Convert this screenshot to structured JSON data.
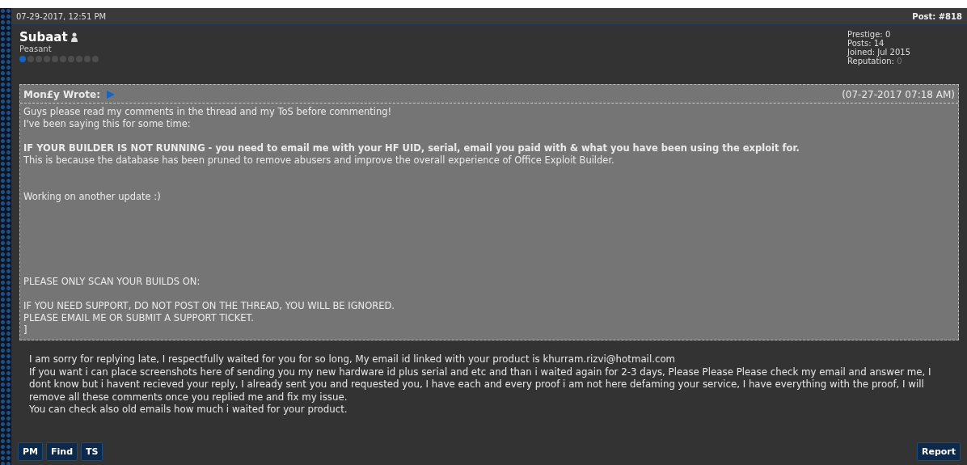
{
  "post": {
    "date": "07-29-2017, 12:51 PM",
    "number": "Post: #818"
  },
  "author": {
    "name": "Subaat",
    "title": "Peasant",
    "stars": 1,
    "stats": [
      {
        "label": "Prestige:",
        "value": "0",
        "muted": false
      },
      {
        "label": "Posts:",
        "value": "14",
        "muted": false
      },
      {
        "label": "Joined:",
        "value": "Jul 2015",
        "muted": false
      },
      {
        "label": "Reputation:",
        "value": "0",
        "muted": true
      }
    ]
  },
  "quote": {
    "author": "Mon£y Wrote:",
    "date": "(07-27-2017 07:18 AM)",
    "lines": [
      {
        "kind": "text",
        "text": "Guys please read my comments in the thread and my ToS before commenting!"
      },
      {
        "kind": "text",
        "text": "I've been saying this for some time:"
      },
      {
        "kind": "spacer"
      },
      {
        "kind": "bold",
        "text": "IF YOUR BUILDER IS NOT RUNNING - you need to email me with your HF UID, serial, email you paid with & what you have been using the exploit for."
      },
      {
        "kind": "text",
        "text": "This is because the database has been pruned to remove abusers and improve the overall experience of Office Exploit Builder."
      },
      {
        "kind": "spacer"
      },
      {
        "kind": "spacer"
      },
      {
        "kind": "text",
        "text": "Working on another update :)"
      },
      {
        "kind": "spacer"
      },
      {
        "kind": "spacer"
      },
      {
        "kind": "spacer"
      },
      {
        "kind": "spacer"
      },
      {
        "kind": "spacer"
      },
      {
        "kind": "spacer"
      },
      {
        "kind": "text",
        "text": "PLEASE ONLY SCAN YOUR BUILDS ON:"
      },
      {
        "kind": "spacer"
      },
      {
        "kind": "text",
        "text": "IF YOU NEED SUPPORT, DO NOT POST ON THE THREAD, YOU WILL BE IGNORED."
      },
      {
        "kind": "text",
        "text": "PLEASE EMAIL ME OR SUBMIT A SUPPORT TICKET."
      },
      {
        "kind": "text",
        "text": "]"
      }
    ]
  },
  "message": [
    "I am sorry for replying late, I respectfully waited for you for so long, My email id linked with your product is khurram.rizvi@hotmail.com",
    "If you want i can place screenshots here of sending you my new hardware id plus serial and etc and than i waited again for 2-3 days, Please Please Please check my email and answer me, I dont know but i havent recieved your reply, I already sent you and requested you, I have each and every proof i am not here defaming your service, I have everything with the proof, I will remove all these comments once you replied me and fix my issue.",
    "You can check also old emails how much i waited for your product."
  ],
  "buttons": [
    "PM",
    "Find",
    "TS"
  ],
  "report_button": "Report"
}
